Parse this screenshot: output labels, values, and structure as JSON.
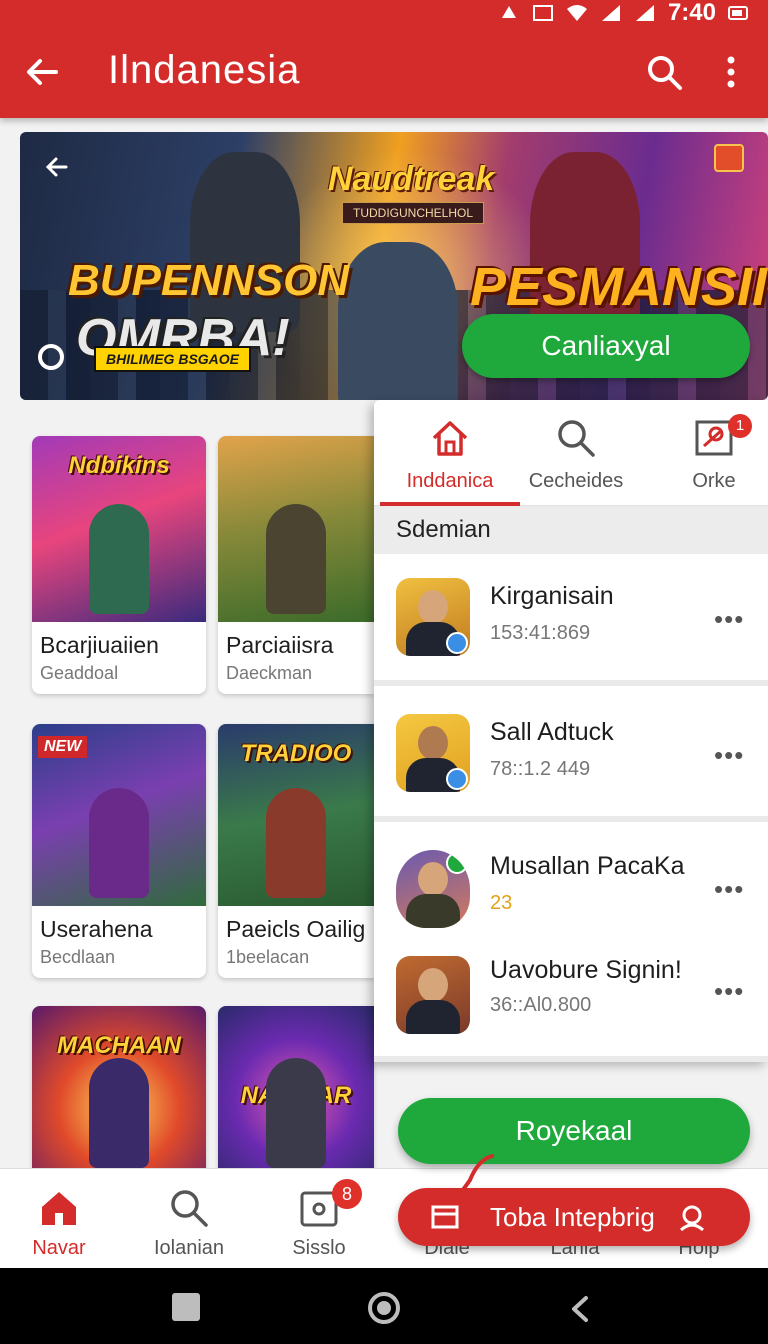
{
  "status_bar": {
    "time": "7:40"
  },
  "app_bar": {
    "title": "Ilndanesia"
  },
  "banner": {
    "headline_top": "Naudtreak",
    "headline_sub": "TUDDIGUNCHELHOL",
    "left_line1": "BUPENNSON",
    "left_line2": "OMRBA!",
    "left_strip": "BHILIMEG BSGAOE",
    "right_title": "PESMANSII",
    "cta_label": "Canliaxyal"
  },
  "games": [
    {
      "name": "Bcarjiuaiien",
      "sub": "Geaddoal",
      "poster_title": "Ndbikins"
    },
    {
      "name": "Parciaiisra",
      "sub": "Daeckman",
      "poster_title": ""
    },
    {
      "name": "Userahena",
      "sub": "Becdlaan",
      "poster_title": "NEW"
    },
    {
      "name": "Paeicls Oailig",
      "sub": "1beelacan",
      "poster_title": "TRADIOO"
    },
    {
      "name": "",
      "sub": "",
      "poster_title": "MACHAAN"
    },
    {
      "name": "",
      "sub": "",
      "poster_title": "NANDIAR"
    }
  ],
  "panel": {
    "tabs": [
      {
        "label": "Inddanica",
        "icon": "home-icon"
      },
      {
        "label": "Cecheides",
        "icon": "search-icon"
      },
      {
        "label": "Orke",
        "icon": "message-icon",
        "badge": "1"
      }
    ],
    "section_title": "Sdemian",
    "chats": [
      {
        "name": "Kirganisain",
        "meta": "153:41:869"
      },
      {
        "name": "Sall Adtuck",
        "meta": "78::1.2 449"
      },
      {
        "name": "Musallan PacaKa",
        "meta": "23"
      },
      {
        "name": "Uavobure Signin!",
        "meta": "36::Al0.800"
      }
    ]
  },
  "buttons": {
    "green_label": "Royekaal",
    "red_label": "Toba Intepbrig"
  },
  "bottom_nav": [
    {
      "label": "Navar",
      "icon": "home-icon"
    },
    {
      "label": "Iolanian",
      "icon": "search-icon"
    },
    {
      "label": "Sisslo",
      "icon": "camera-icon",
      "badge": "8"
    },
    {
      "label": "Diale",
      "icon": ""
    },
    {
      "label": "Lania",
      "icon": ""
    },
    {
      "label": "Holp",
      "icon": ""
    }
  ],
  "colors": {
    "primary_red": "#d32c2a",
    "accent_green": "#1fa83c"
  }
}
